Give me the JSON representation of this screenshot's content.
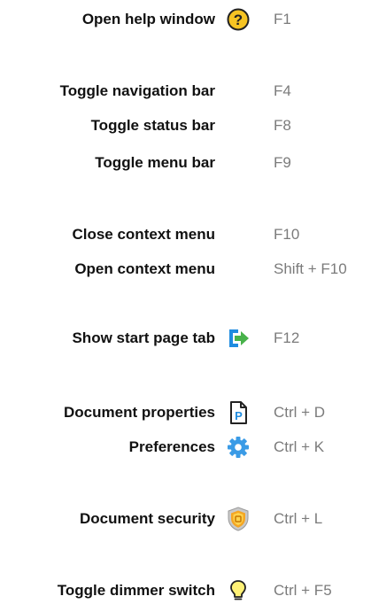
{
  "shortcuts": [
    {
      "label": "Open help window",
      "icon": "help-icon",
      "key": "F1"
    },
    {
      "label": "Toggle navigation bar",
      "icon": "",
      "key": "F4"
    },
    {
      "label": "Toggle status bar",
      "icon": "",
      "key": "F8"
    },
    {
      "label": "Toggle menu bar",
      "icon": "",
      "key": "F9"
    },
    {
      "label": "Close context menu",
      "icon": "",
      "key": "F10"
    },
    {
      "label": "Open context menu",
      "icon": "",
      "key": "Shift + F10"
    },
    {
      "label": "Show start page tab",
      "icon": "start-page-icon",
      "key": "F12"
    },
    {
      "label": "Document properties",
      "icon": "document-properties-icon",
      "key": "Ctrl + D"
    },
    {
      "label": "Preferences",
      "icon": "gear-icon",
      "key": "Ctrl + K"
    },
    {
      "label": "Document security",
      "icon": "security-shield-icon",
      "key": "Ctrl + L"
    },
    {
      "label": "Toggle dimmer switch",
      "icon": "lightbulb-icon",
      "key": "Ctrl + F5"
    }
  ],
  "colors": {
    "label": "#111111",
    "key": "#7b7b7b",
    "help_yellow": "#f6c423",
    "start_green": "#48b24a",
    "start_blue": "#1f8ce0",
    "gear_blue": "#3a9be6",
    "shield_orange": "#f5a623",
    "bulb_yellow": "#fff176"
  }
}
